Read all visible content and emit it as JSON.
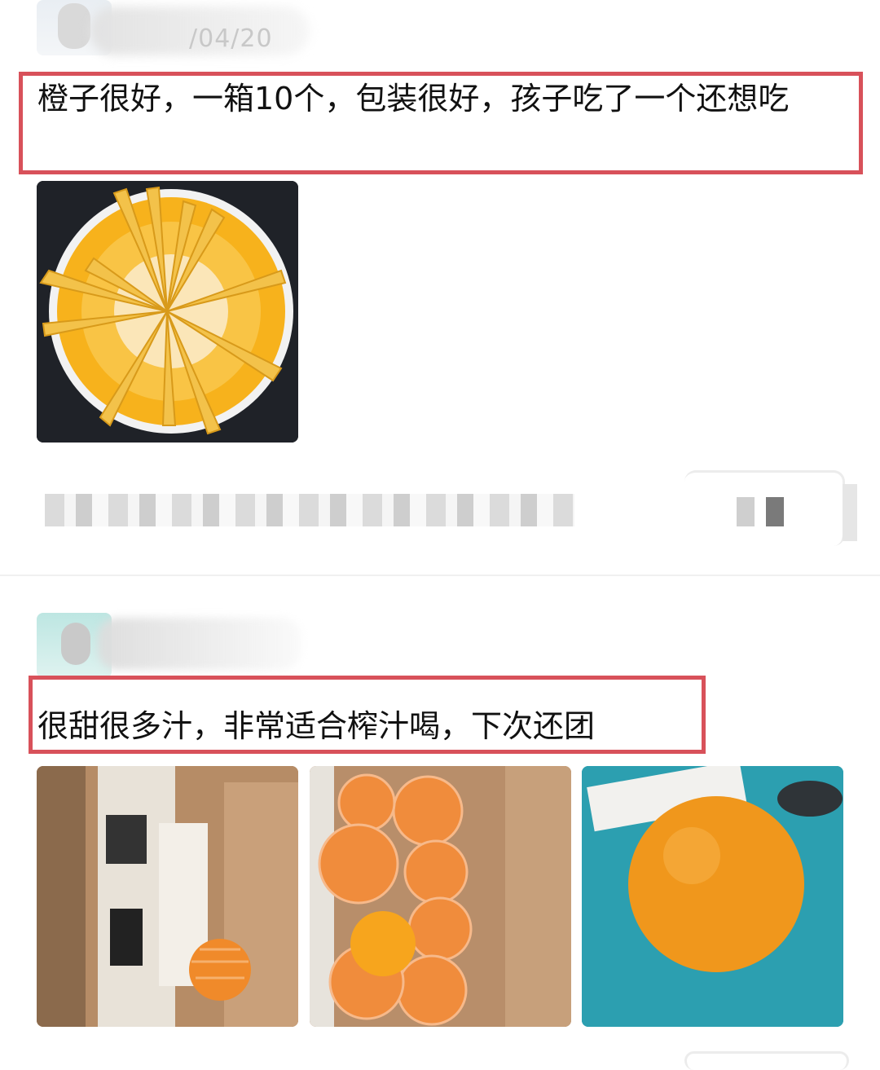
{
  "reviews": [
    {
      "date_fragment": "/04/20",
      "text": "橙子很好，一箱10个，包装很好，孩子吃了一个还想吃",
      "photos": [
        {
          "subject": "orange-peel-on-plate-icon"
        }
      ]
    },
    {
      "text": "很甜很多汁，非常适合榨汁喝，下次还团",
      "photos": [
        {
          "subject": "orange-in-carton-icon"
        },
        {
          "subject": "oranges-in-foam-nets-icon"
        },
        {
          "subject": "single-orange-icon"
        }
      ]
    }
  ],
  "colors": {
    "highlight": "#d8515a",
    "text": "#111111",
    "orange": "#f0971c",
    "plate_yellow": "#f7b21c",
    "teal_table": "#2c9fb0"
  }
}
